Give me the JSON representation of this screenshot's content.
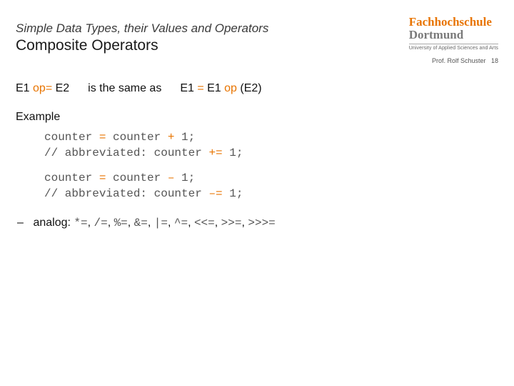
{
  "brand": {
    "line1": "Fachhochschule",
    "line2": "Dortmund",
    "sub": "University of Applied Sciences and Arts"
  },
  "footer": {
    "author": "Prof. Rolf Schuster",
    "page": "18"
  },
  "header": {
    "supertitle": "Simple Data Types, their Values and Operators",
    "title": "Composite Operators"
  },
  "defline": {
    "e1a": "E1 ",
    "opAssign": "op=",
    "e2": " E2",
    "mid": "is the same as",
    "e1b": "E1 ",
    "eq": "=",
    "e1c": " E1 ",
    "op": "op",
    "paren": " (E2)"
  },
  "example": {
    "label": "Example",
    "block1": {
      "l1a": "counter ",
      "l1eq": "=",
      "l1b": " counter ",
      "l1op": "+",
      "l1c": " 1;",
      "l2a": "// abbreviated: counter ",
      "l2op": "+=",
      "l2b": " 1;"
    },
    "block2": {
      "l1a": "counter ",
      "l1eq": "=",
      "l1b": " counter ",
      "l1op": "–",
      "l1c": " 1;",
      "l2a": "// abbreviated: counter ",
      "l2op": "–=",
      "l2b": " 1;"
    }
  },
  "analog": {
    "dash": "–",
    "label": "analog:  ",
    "sep": ", ",
    "ops": [
      "*=",
      "/=",
      "%=",
      "&=",
      "|=",
      "^=",
      "<<=",
      ">>=",
      ">>>="
    ]
  }
}
